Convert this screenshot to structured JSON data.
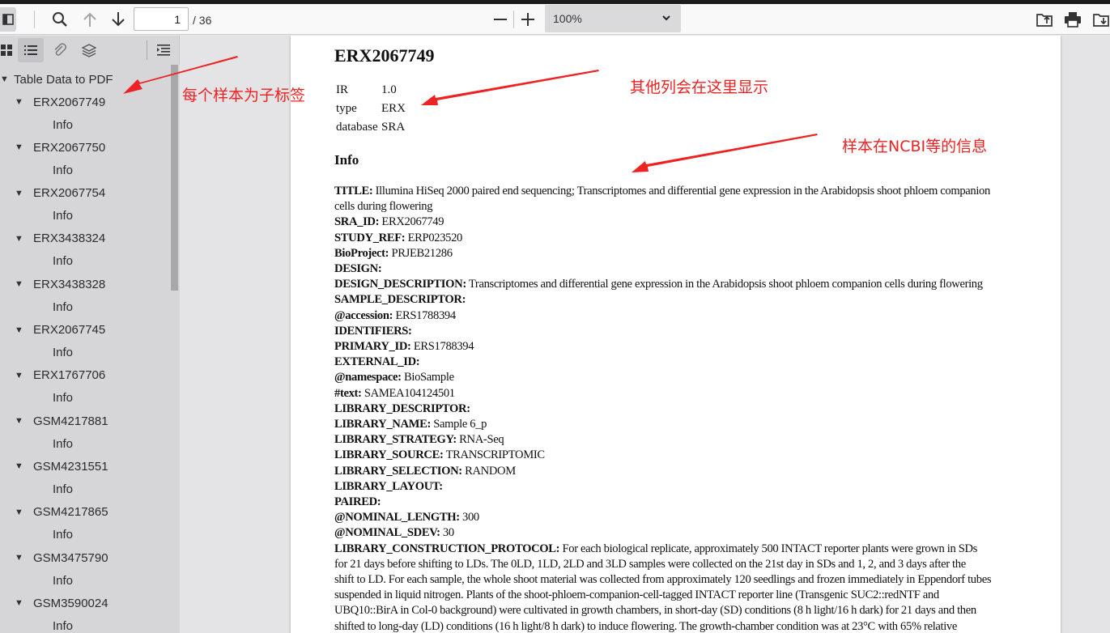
{
  "toolbar": {
    "page_number": "1",
    "page_total": "/ 36",
    "zoom": "100%",
    "icons": [
      "sidebar-toggle-icon",
      "search-icon",
      "arrow-up-icon",
      "arrow-down-icon",
      "zoom-out-icon",
      "zoom-in-icon",
      "chevron-down-icon",
      "open-file-icon",
      "print-icon",
      "save-icon"
    ]
  },
  "sidebar": {
    "tools": [
      "thumbnails-icon",
      "outline-icon",
      "attachments-icon",
      "layers-icon",
      "current-outline-item-icon"
    ],
    "root": "Table Data to PDF",
    "items": [
      {
        "label": "ERX2067749",
        "child": "Info"
      },
      {
        "label": "ERX2067750",
        "child": "Info"
      },
      {
        "label": "ERX2067754",
        "child": "Info"
      },
      {
        "label": "ERX3438324",
        "child": "Info"
      },
      {
        "label": "ERX3438328",
        "child": "Info"
      },
      {
        "label": "ERX2067745",
        "child": "Info"
      },
      {
        "label": "ERX1767706",
        "child": "Info"
      },
      {
        "label": "GSM4217881",
        "child": "Info"
      },
      {
        "label": "GSM4231551",
        "child": "Info"
      },
      {
        "label": "GSM4217865",
        "child": "Info"
      },
      {
        "label": "GSM3475790",
        "child": "Info"
      },
      {
        "label": "GSM3590024",
        "child": "Info"
      }
    ]
  },
  "document": {
    "title": "ERX2067749",
    "fields": [
      {
        "key": "IR",
        "value": "1.0"
      },
      {
        "key": "type",
        "value": "ERX"
      },
      {
        "key": "database",
        "value": "SRA"
      }
    ],
    "info_heading": "Info",
    "lines": [
      {
        "b": "TITLE:",
        "t": " Illumina HiSeq 2000 paired end sequencing; Transcriptomes and differential gene expression in the Arabidopsis shoot phloem companion"
      },
      {
        "b": "",
        "t": "cells during flowering"
      },
      {
        "b": "SRA_ID:",
        "t": " ERX2067749"
      },
      {
        "b": "STUDY_REF:",
        "t": " ERP023520"
      },
      {
        "b": "BioProject:",
        "t": " PRJEB21286"
      },
      {
        "b": "DESIGN:",
        "t": ""
      },
      {
        "b": "DESIGN_DESCRIPTION:",
        "t": " Transcriptomes and differential gene expression in the Arabidopsis shoot phloem companion cells during flowering"
      },
      {
        "b": "SAMPLE_DESCRIPTOR:",
        "t": ""
      },
      {
        "b": "@accession:",
        "t": " ERS1788394"
      },
      {
        "b": "IDENTIFIERS:",
        "t": ""
      },
      {
        "b": "PRIMARY_ID:",
        "t": " ERS1788394"
      },
      {
        "b": "EXTERNAL_ID:",
        "t": ""
      },
      {
        "b": "@namespace:",
        "t": " BioSample"
      },
      {
        "b": "#text:",
        "t": " SAMEA104124501"
      },
      {
        "b": "LIBRARY_DESCRIPTOR:",
        "t": ""
      },
      {
        "b": "LIBRARY_NAME:",
        "t": " Sample 6_p"
      },
      {
        "b": "LIBRARY_STRATEGY:",
        "t": " RNA-Seq"
      },
      {
        "b": "LIBRARY_SOURCE:",
        "t": " TRANSCRIPTOMIC"
      },
      {
        "b": "LIBRARY_SELECTION:",
        "t": " RANDOM"
      },
      {
        "b": "LIBRARY_LAYOUT:",
        "t": ""
      },
      {
        "b": "PAIRED:",
        "t": ""
      },
      {
        "b": "@NOMINAL_LENGTH:",
        "t": " 300"
      },
      {
        "b": "@NOMINAL_SDEV:",
        "t": " 30"
      },
      {
        "b": "LIBRARY_CONSTRUCTION_PROTOCOL:",
        "t": " For each biological replicate, approximately 500 INTACT reporter plants were grown in SDs"
      },
      {
        "b": "",
        "t": "for 21 days before shifting to LDs. The 0LD, 1LD, 2LD and 3LD samples were collected on the 21st day in SDs and 1, 2, and 3 days after the"
      },
      {
        "b": "",
        "t": "shift to LD. For each sample, the whole shoot material was collected from approximately 120 seedlings and frozen immediately in Eppendorf tubes"
      },
      {
        "b": "",
        "t": "suspended in liquid nitrogen. Plants of the shoot-phloem-companion-cell-tagged INTACT reporter line (Transgenic SUC2::redNTF and"
      },
      {
        "b": "",
        "t": "UBQ10::BirA in Col-0 background) were cultivated in growth chambers, in short-day (SD) conditions (8 h light/16 h dark) for 21 days and then"
      },
      {
        "b": "",
        "t": "shifted to long-day (LD) conditions (16 h light/8 h dark) to induce flowering. The growth-chamber condition was at 23°C with 65% relative"
      }
    ]
  },
  "annotations": {
    "subtag": "每个样本为子标签",
    "other_columns": "其他列会在这里显示",
    "ncbi_info": "样本在NCBI等的信息",
    "color": "#ee2222"
  }
}
